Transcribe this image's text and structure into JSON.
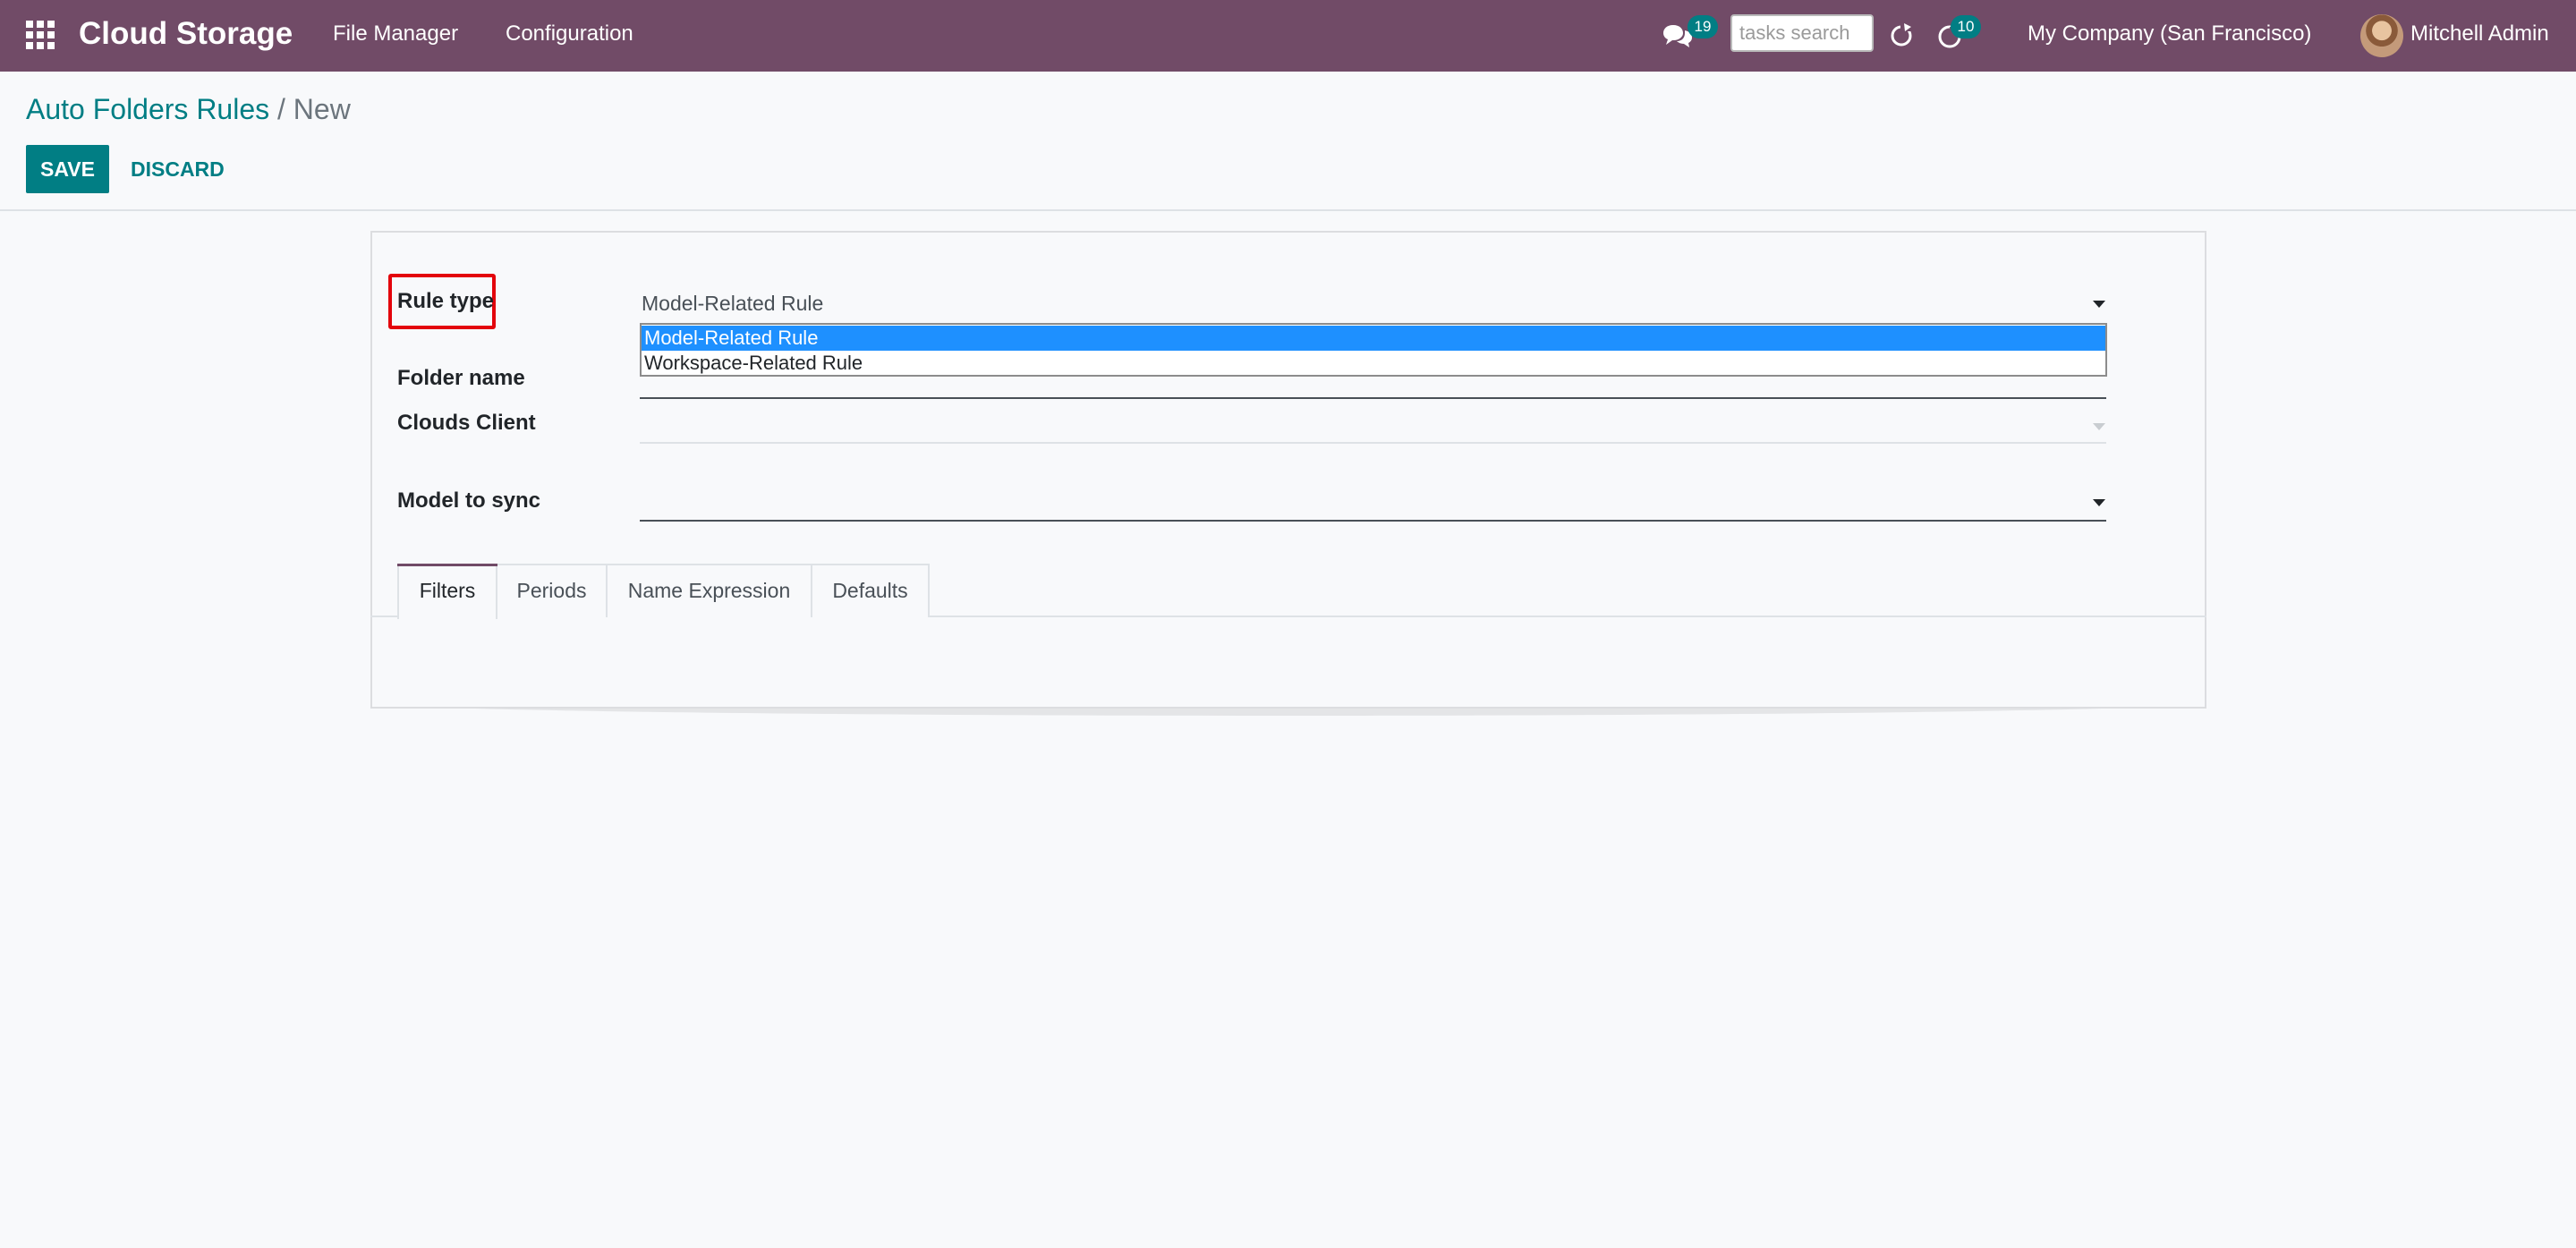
{
  "navbar": {
    "app_title": "Cloud Storage",
    "menu": [
      "File Manager",
      "Configuration"
    ],
    "messages_badge": "19",
    "search_placeholder": "tasks search",
    "activities_badge": "10",
    "company": "My Company (San Francisco)",
    "user": "Mitchell Admin"
  },
  "breadcrumb": {
    "parent": "Auto Folders Rules",
    "separator": "/",
    "current": "New"
  },
  "buttons": {
    "save": "SAVE",
    "discard": "DISCARD"
  },
  "form": {
    "rule_type_label": "Rule type",
    "rule_type_value": "Model-Related Rule",
    "rule_type_options": [
      "Model-Related Rule",
      "Workspace-Related Rule"
    ],
    "folder_name_label": "Folder name",
    "clouds_client_label": "Clouds Client",
    "model_to_sync_label": "Model to sync"
  },
  "tabs": [
    "Filters",
    "Periods",
    "Name Expression",
    "Defaults"
  ],
  "colors": {
    "navbar": "#714b67",
    "primary": "#017e84",
    "highlight": "#e3040c",
    "dropdown_selected": "#1e90ff"
  }
}
